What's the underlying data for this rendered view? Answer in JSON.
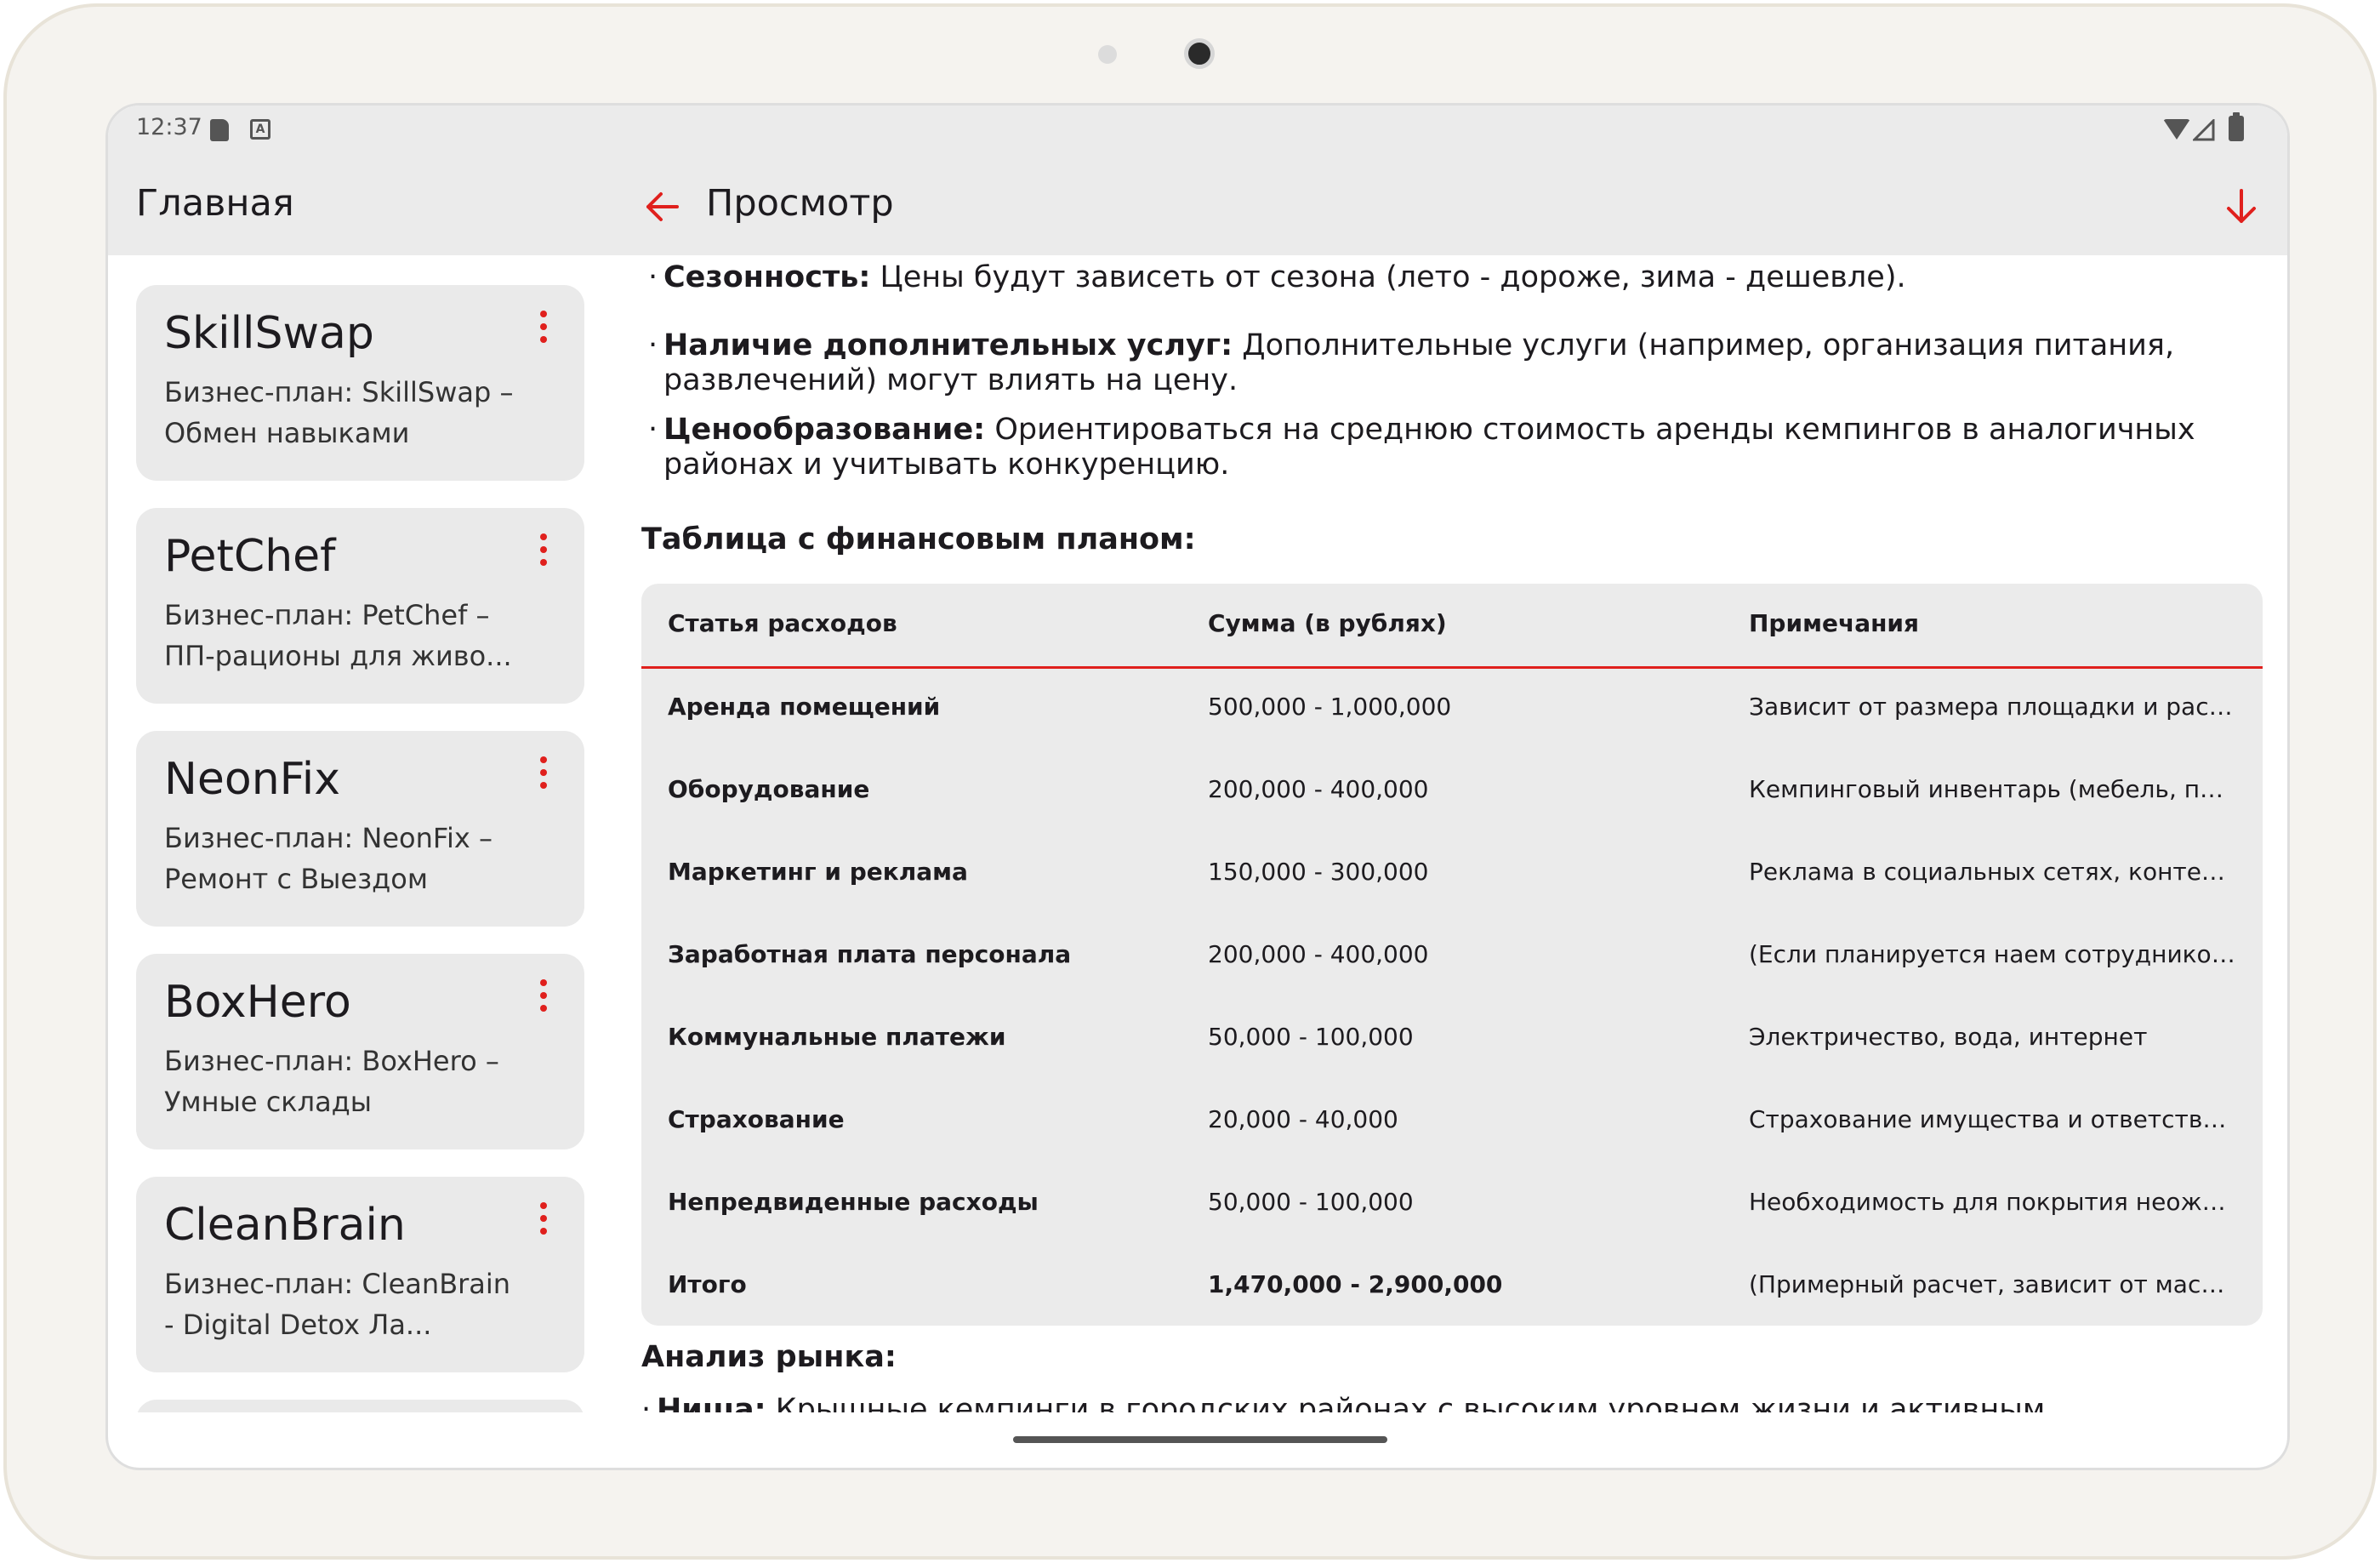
{
  "status": {
    "time": "12:37"
  },
  "appbar": {
    "main_title": "Главная",
    "view_title": "Просмотр"
  },
  "colors": {
    "accent": "#e0201d",
    "surface": "#ebebeb",
    "card": "#eaeaea"
  },
  "list": {
    "items": [
      {
        "title": "SkillSwap",
        "subtitle": "Бизнес-план: SkillSwap – Обмен навыками"
      },
      {
        "title": "PetChef",
        "subtitle": "Бизнес-план: PetChef – ПП-рационы для живо..."
      },
      {
        "title": "NeonFix",
        "subtitle": "Бизнес-план: NeonFix – Ремонт с Выездом"
      },
      {
        "title": "BoxHero",
        "subtitle": "Бизнес-план: BoxHero – Умные склады"
      },
      {
        "title": "CleanBrain",
        "subtitle": "Бизнес-план: CleanBrain - Digital Detox Ла..."
      }
    ]
  },
  "content": {
    "bullet_seasonality": {
      "label": "Сезонность:",
      "text": " Цены будут зависеть от сезона (лето - дороже, зима - дешевле)."
    },
    "bullet_services": {
      "label": "Наличие дополнительных услуг:",
      "text": " Дополнительные услуги (например, организация питания, развлечений) могут влиять на цену."
    },
    "bullet_pricing": {
      "label": "Ценообразование:",
      "text": " Ориентироваться на среднюю стоимость аренды кемпингов в аналогичных районах и учитывать конкуренцию."
    },
    "table_heading": "Таблица с финансовым планом:",
    "table": {
      "headers": [
        "Статья расходов",
        "Сумма (в рублях)",
        "Примечания"
      ],
      "rows": [
        [
          "Аренда помещений",
          "500,000 - 1,000,000",
          "Зависит от размера площадки и располо..."
        ],
        [
          "Оборудование",
          "200,000 - 400,000",
          "Кемпинговый инвентарь (мебель, палатк..."
        ],
        [
          "Маркетинг и реклама",
          "150,000 - 300,000",
          "Реклама в социальных сетях, контекстна..."
        ],
        [
          "Заработная плата персонала",
          "200,000 - 400,000",
          "(Если планируется наем сотрудников для..."
        ],
        [
          "Коммунальные платежи",
          "50,000 - 100,000",
          "Электричество, вода, интернет"
        ],
        [
          "Страхование",
          "20,000 - 40,000",
          "Страхование имущества и ответственнос..."
        ],
        [
          "Непредвиденные расходы",
          "50,000 - 100,000",
          "Необходимость для покрытия неожидан..."
        ],
        [
          "Итого",
          "1,470,000 - 2,900,000",
          "(Примерный расчет, зависит от масштаб..."
        ]
      ]
    },
    "market_heading": "Анализ рынка:",
    "bullet_niche": {
      "label": "Ниша:",
      "text": " Крышные кемпинги в городских районах с высоким уровнем жизни и активным молодежным"
    }
  }
}
